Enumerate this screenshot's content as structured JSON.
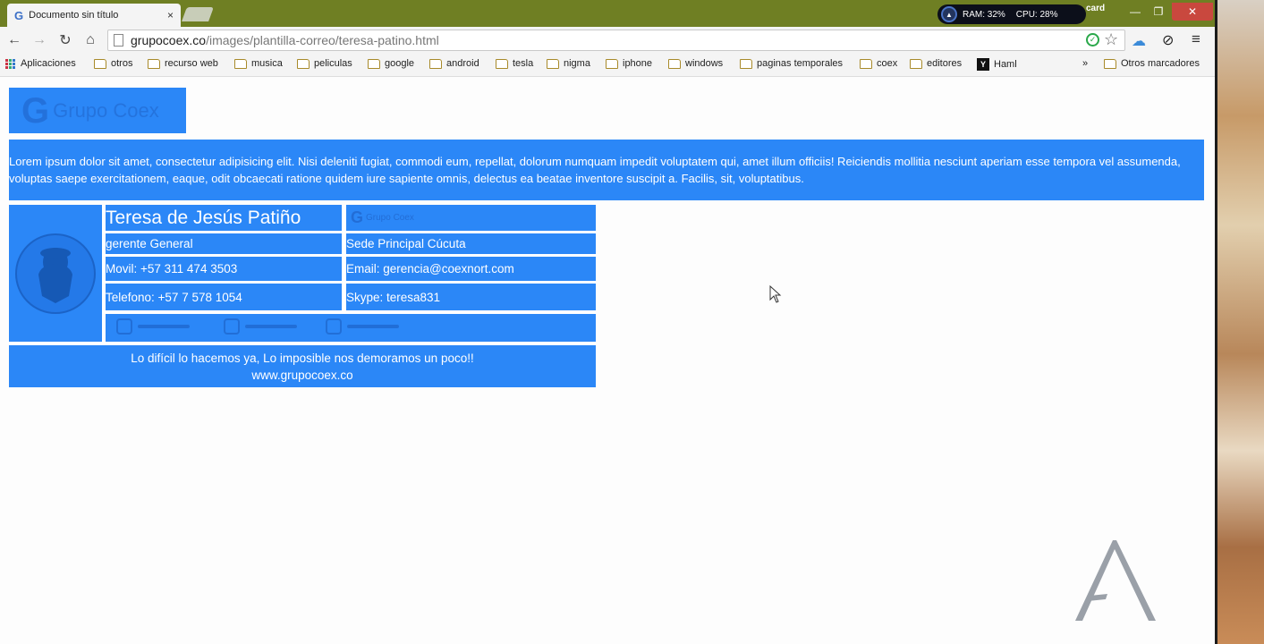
{
  "browser": {
    "tab_title": "Documento sin título",
    "tab_close": "×",
    "sysmon": {
      "ram": "RAM: 32%",
      "cpu": "CPU: 28%"
    },
    "profile_name": "card",
    "url_host": "grupocoex.co",
    "url_path": "/images/plantilla-correo/teresa-patino.html",
    "icons": [
      "back-icon",
      "forward-icon",
      "reload-icon",
      "home-icon",
      "page-icon",
      "check-icon",
      "star-icon",
      "cloud-icon",
      "extension-icon",
      "menu-icon"
    ]
  },
  "bookmarks": {
    "apps": "Aplicaciones",
    "items": [
      "otros",
      "recurso web",
      "musica",
      "peliculas",
      "google",
      "android",
      "tesla",
      "nigma",
      "iphone",
      "windows",
      "paginas temporales",
      "coex",
      "editores"
    ],
    "haml": "Haml",
    "more": "»",
    "other": "Otros marcadores"
  },
  "page": {
    "logo_text": "Grupo Coex",
    "intro": "Lorem ipsum dolor sit amet, consectetur adipisicing elit. Nisi deleniti fugiat, commodi eum, repellat, dolorum numquam impedit voluptatem qui, amet illum officiis! Reiciendis mollitia nesciunt aperiam esse tempora vel assumenda, voluptas saepe exercitationem, eaque, odit obcaecati ratione quidem iure sapiente omnis, delectus ea beatae inventore suscipit a. Facilis, sit, voluptatibus.",
    "signature": {
      "name": "Teresa de Jesús Patiño",
      "logo_small": "Grupo Coex",
      "role": "gerente General",
      "office": "Sede Principal Cúcuta",
      "mobile": "Movil: +57 311 474 3503",
      "email": "Email: gerencia@coexnort.com",
      "phone": "Telefono: +57 7 578 1054",
      "skype": "Skype: teresa831",
      "slogan": "Lo difícil lo hacemos ya, Lo imposible nos demoramos un poco!!",
      "website": "www.grupocoex.co"
    }
  },
  "colors": {
    "accent_blue": "#2b87f7",
    "titlebar": "#6f7f23",
    "close_red": "#c9483e"
  }
}
